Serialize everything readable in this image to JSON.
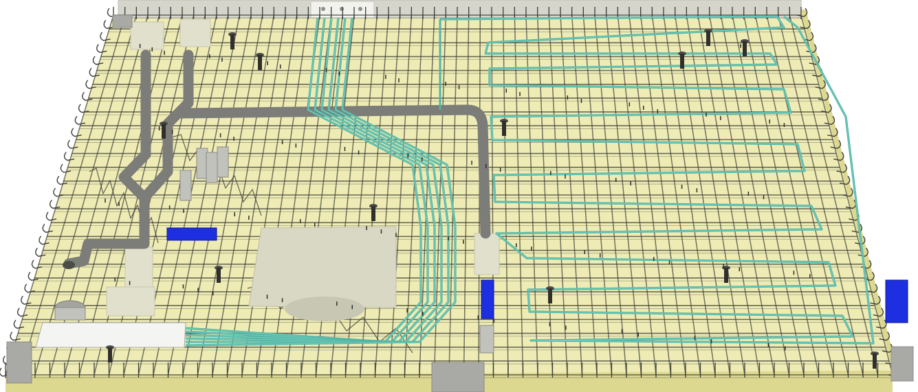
{
  "scene": {
    "subject": "rebar-slab-render",
    "colors": {
      "slab": "#eeecb4",
      "slab_edge": "#e7e4a4",
      "slab_face": "#dcd88f",
      "rebar": "#3c3c38",
      "rebar_light": "#6f6f66",
      "duct": "#7c7c78",
      "duct_dark": "#4b4b47",
      "conduit": "#52b4a4",
      "conduit_light": "#7fd7c8",
      "block": "#e0e0cc",
      "beam": "#d5d5cc",
      "blue_box": "#1d2fe0",
      "concrete_spacer": "#a9a9a5"
    }
  }
}
